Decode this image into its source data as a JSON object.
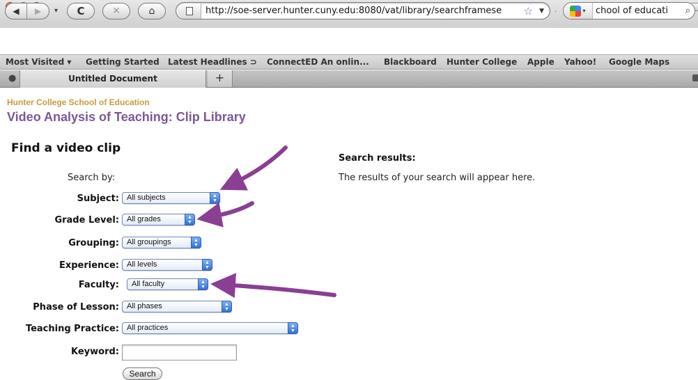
{
  "window": {
    "title": "Untitled Document"
  },
  "toolbar": {
    "url": "http://soe-server.hunter.cuny.edu:8080/vat/library/searchframese",
    "search_text": "chool of educati"
  },
  "bookmarks": [
    "Most Visited ▾",
    "Getting Started",
    "Latest Headlines ⊃",
    "ConnectED An onlin...",
    "Blackboard",
    "Hunter College",
    "Apple",
    "Yahoo!",
    "Google Maps"
  ],
  "tabs": [
    {
      "label": "Untitled Document"
    }
  ],
  "page": {
    "school": "Hunter College School of Education",
    "library_title": "Video Analysis of Teaching: Clip Library",
    "heading": "Find a video clip",
    "search_by": "Search by:",
    "filters": [
      {
        "label": "Subject:",
        "value": "All subjects"
      },
      {
        "label": "Grade Level:",
        "value": "All grades"
      },
      {
        "label": "Grouping:",
        "value": "All groupings"
      },
      {
        "label": "Experience:",
        "value": "All levels"
      },
      {
        "label": "Faculty:",
        "value": "All faculty"
      },
      {
        "label": "Phase of Lesson:",
        "value": "All phases"
      },
      {
        "label": "Teaching Practice:",
        "value": "All practices"
      }
    ],
    "keyword_label": "Keyword:",
    "keyword_value": "",
    "search_button": "Search",
    "results_title": "Search results:",
    "results_text": "The results of your search will appear here."
  },
  "colors": {
    "school": "#c89a3c",
    "title": "#7b5799",
    "arrow": "#8a3f93"
  }
}
